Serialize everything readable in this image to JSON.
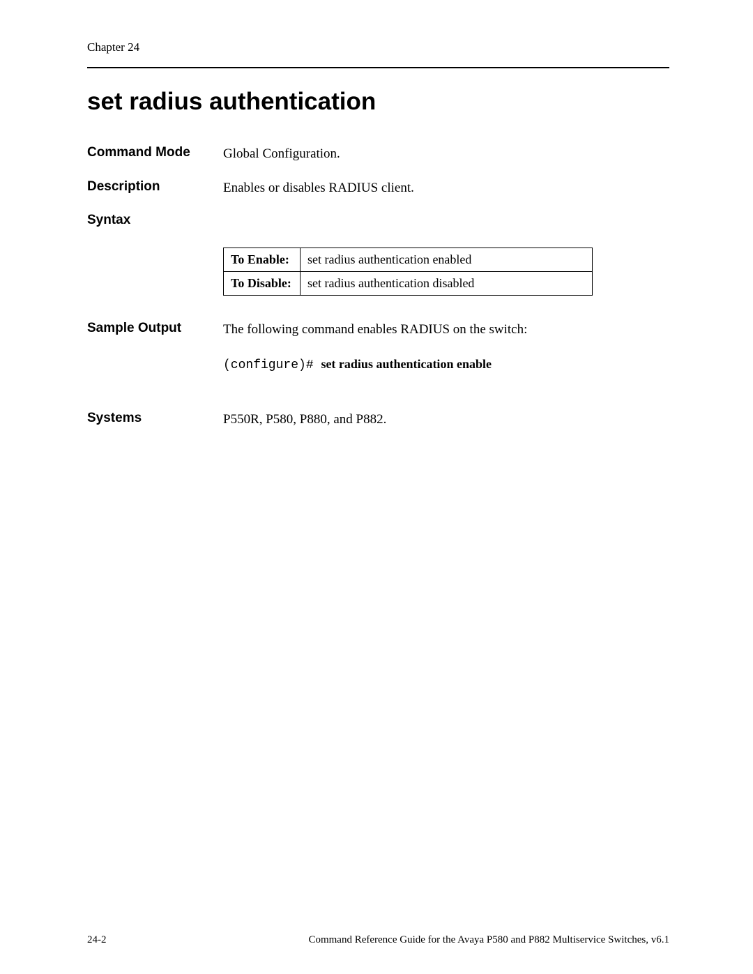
{
  "header": {
    "chapter": "Chapter 24"
  },
  "title": "set radius authentication",
  "sections": {
    "command_mode": {
      "label": "Command Mode",
      "value": "Global Configuration."
    },
    "description": {
      "label": "Description",
      "value": "Enables or disables RADIUS client."
    },
    "syntax": {
      "label": "Syntax",
      "rows": [
        {
          "header": "To Enable:",
          "value": "set radius authentication enabled"
        },
        {
          "header": "To Disable:",
          "value": "set radius authentication disabled"
        }
      ]
    },
    "sample_output": {
      "label": "Sample Output",
      "intro": "The following command enables RADIUS on the switch:",
      "prompt": "(configure)# ",
      "command": "set radius authentication enable"
    },
    "systems": {
      "label": "Systems",
      "value": "P550R, P580, P880, and P882."
    }
  },
  "footer": {
    "page_number": "24-2",
    "doc_title": "Command Reference Guide for the Avaya P580 and P882 Multiservice Switches, v6.1"
  }
}
